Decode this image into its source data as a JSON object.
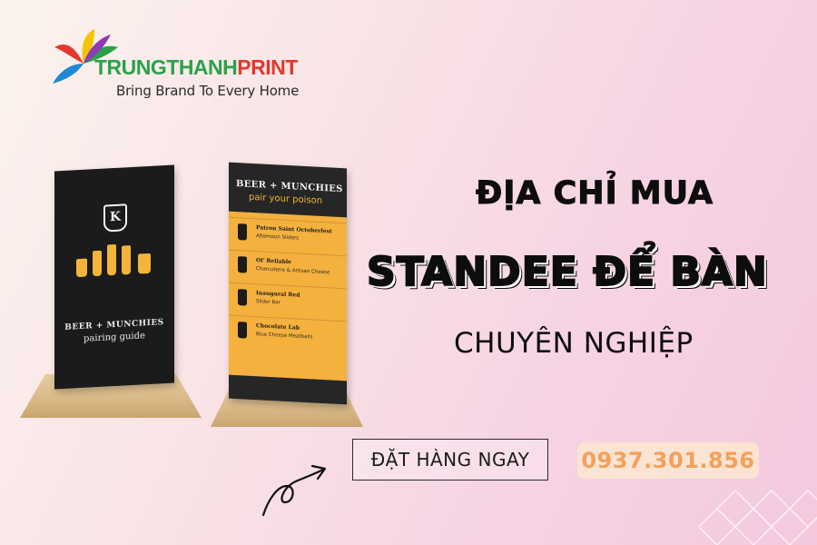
{
  "brand": {
    "name_part1": "TRUNGTHANH",
    "name_part2": "PRINT",
    "slogan": "Bring Brand To Every Home"
  },
  "headline": {
    "line1": "ĐỊA CHỈ MUA",
    "line2": "STANDEE ĐỂ BÀN",
    "line3": "CHUYÊN NGHIỆP"
  },
  "cta": {
    "order_label": "ĐẶT HÀNG NGAY",
    "phone": "0937.301.856"
  },
  "product_left": {
    "logo_letter": "K",
    "brand_line": "BEER + MUNCHIES",
    "subtitle": "pairing guide"
  },
  "product_right": {
    "heading": "BEER + MUNCHIES",
    "subheading": "pair your poison",
    "items": [
      {
        "title": "Patron Saint Octoberfest",
        "pairing": "Afternoon Sliders"
      },
      {
        "title": "Ol' Reliable",
        "pairing": "Charcuterie & Artisan Cheese"
      },
      {
        "title": "Inaugural Red",
        "pairing": "Slider Bar"
      },
      {
        "title": "Chocolate Lab",
        "pairing": "Blue Cheese Meatballs"
      }
    ]
  },
  "colors": {
    "brand_green": "#2aa24a",
    "brand_red": "#e2382c",
    "phone_text": "#f4a05a",
    "phone_bg": "#fbe4d4"
  }
}
